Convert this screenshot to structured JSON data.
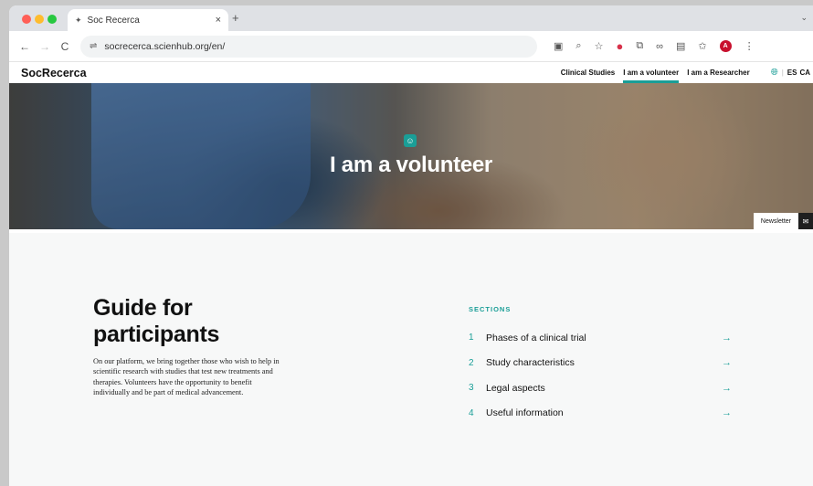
{
  "browser": {
    "tab_title": "Soc Recerca",
    "tab_close": "×",
    "new_tab": "+",
    "url": "socrecerca.scienhub.org/en/",
    "nav_back": "←",
    "nav_forward": "→",
    "nav_reload": "C",
    "profile_initial": "A"
  },
  "site": {
    "logo": "SocRecerca",
    "nav": [
      "Clinical Studies",
      "I am a volunteer",
      "I am a Researcher"
    ],
    "lang_es": "ES",
    "lang_ca": "CA"
  },
  "hero": {
    "title": "I am a volunteer",
    "newsletter": "Newsletter"
  },
  "main": {
    "guide_title": "Guide for participants",
    "guide_text": "On our platform, we bring together those who wish to help in scientific research with studies that test new treatments and therapies. Volunteers have the opportunity to benefit individually and be part of medical advancement.",
    "sections_label": "SECTIONS",
    "sections": [
      {
        "num": "1",
        "label": "Phases of a clinical trial"
      },
      {
        "num": "2",
        "label": "Study characteristics"
      },
      {
        "num": "3",
        "label": "Legal aspects"
      },
      {
        "num": "4",
        "label": "Useful information"
      }
    ]
  },
  "colors": {
    "accent": "#1a9e97"
  }
}
